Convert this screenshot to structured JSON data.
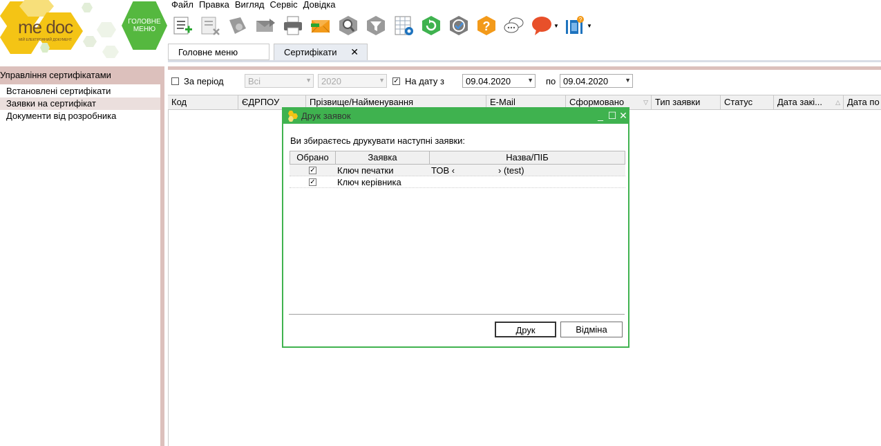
{
  "app": {
    "logo_text": "me doc",
    "logo_subtitle": "МІЙ ЕЛЕКТРОННИЙ ДОКУМЕНТ",
    "home_button": "ГОЛОВНЕ МЕНЮ"
  },
  "menu": [
    "Файл",
    "Правка",
    "Вигляд",
    "Сервіс",
    "Довідка"
  ],
  "toolbar": {
    "icons": [
      "add-document-icon",
      "delete-document-icon",
      "certificate-icon",
      "send-icon",
      "print-icon",
      "mail-icon",
      "search-certificate-icon",
      "filter-icon",
      "table-settings-icon",
      "refresh-icon",
      "verify-icon",
      "help-icon",
      "chat-icon",
      "message-icon",
      "video-icon"
    ]
  },
  "tabs": [
    {
      "label": "Головне меню",
      "active": false
    },
    {
      "label": "Сертифікати",
      "active": true,
      "closable": true
    }
  ],
  "sidebar": {
    "title": "Управління сертифікатами",
    "items": [
      "Встановлені сертифікати",
      "Заявки на сертифікат",
      "Документи від розробника"
    ],
    "selected_index": 1
  },
  "filter": {
    "period_label": "За період",
    "period_checked": false,
    "period_value": "Всі",
    "year_value": "2020",
    "on_date_label": "На дату з",
    "on_date_checked": true,
    "date_from": "09.04.2020",
    "to_label": "по",
    "date_to": "09.04.2020"
  },
  "grid": {
    "columns": [
      "Код",
      "ЄДРПОУ",
      "Прізвище/Найменування",
      "E-Mail",
      "Сформовано",
      "Тип заявки",
      "Статус",
      "Дата закі...",
      "Дата по"
    ]
  },
  "dialog": {
    "title": "Друк заявок",
    "message": "Ви збираєтесь друкувати наступні заявки:",
    "columns": [
      "Обрано",
      "Заявка",
      "Назва/ПІБ"
    ],
    "rows": [
      {
        "selected": true,
        "request": "Ключ печатки",
        "name_prefix": "ТОВ ‹",
        "name_suffix": "› (test)"
      },
      {
        "selected": true,
        "request": "Ключ керівника",
        "name_prefix": "",
        "name_suffix": ""
      }
    ],
    "print_button": "Друк",
    "cancel_button": "Відміна"
  },
  "colors": {
    "accent_green": "#3fb24f",
    "sidebar_tan": "#dcc0bc",
    "logo_yellow": "#f4c415"
  }
}
